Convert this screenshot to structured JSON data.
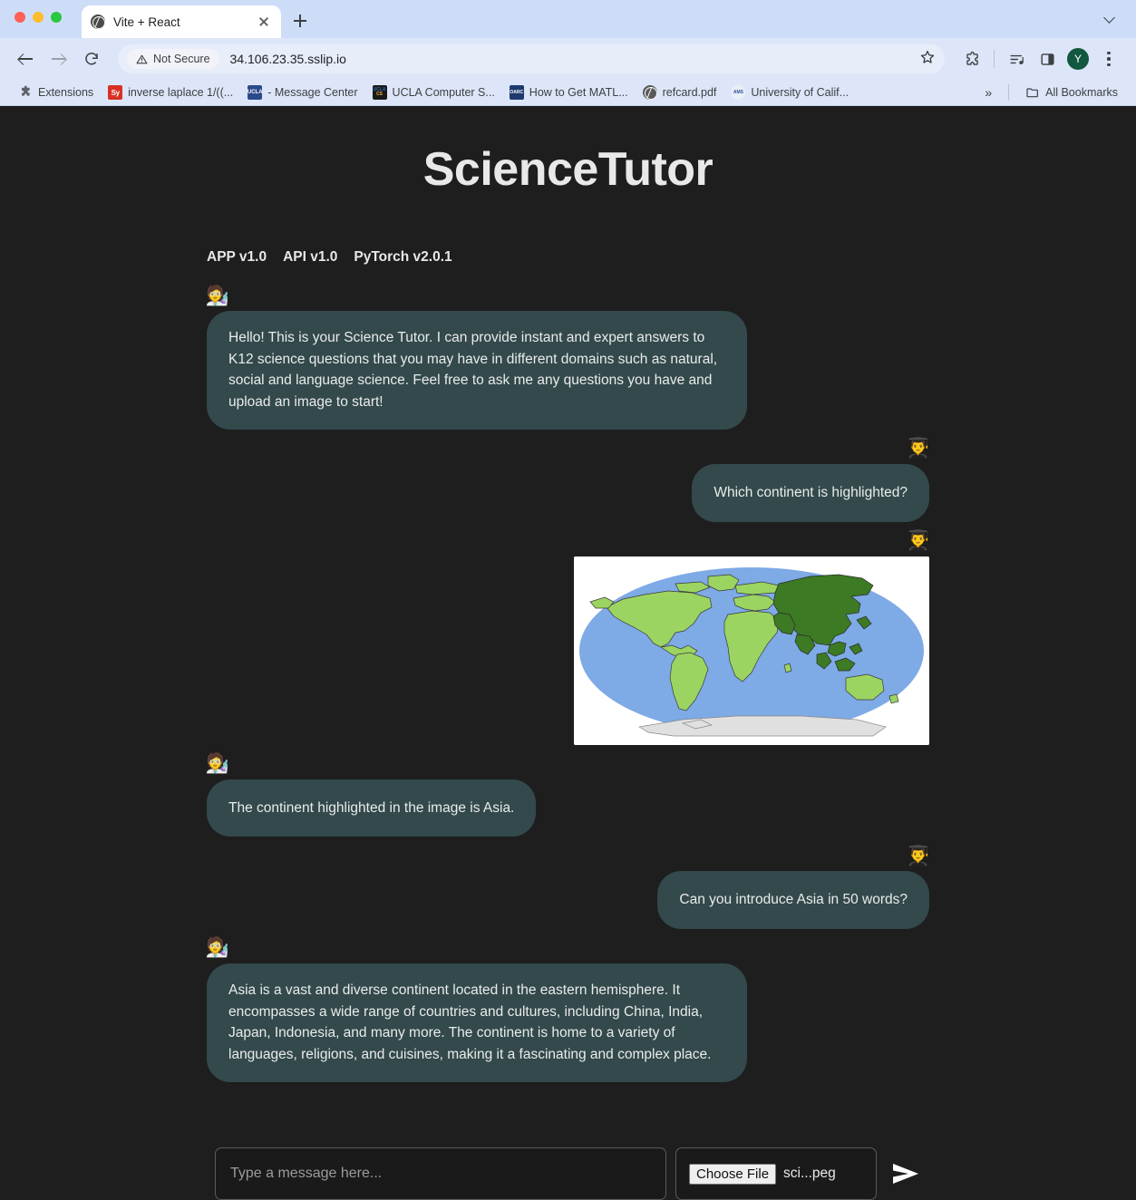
{
  "browser": {
    "tab": {
      "title": "Vite + React",
      "favicon": "globe-icon"
    },
    "new_tab_label": "+",
    "nav": {
      "back": "back-arrow-icon",
      "forward": "forward-arrow-icon",
      "reload": "reload-icon"
    },
    "omnibox": {
      "security_label": "Not Secure",
      "url": "34.106.23.35.sslip.io",
      "bookmark_star": "star-icon"
    },
    "toolbar_icons": [
      "extensions-puzzle-icon",
      "media-control-icon",
      "side-panel-icon",
      "profile-avatar",
      "browser-menu-icon"
    ],
    "profile_initial": "Y",
    "bookmarks": [
      {
        "label": "Extensions",
        "icon": "puzzle-icon"
      },
      {
        "label": "inverse laplace 1/((...",
        "icon": "symbolab-icon"
      },
      {
        "label": "- Message Center",
        "icon": "ucla-icon"
      },
      {
        "label": "UCLA Computer S...",
        "icon": "ucla-cs-icon"
      },
      {
        "label": "How to Get MATL...",
        "icon": "oarc-icon"
      },
      {
        "label": "refcard.pdf",
        "icon": "globe-icon"
      },
      {
        "label": "University of Calif...",
        "icon": "ams-icon"
      }
    ],
    "bookmarks_overflow": "»",
    "all_bookmarks_label": "All Bookmarks"
  },
  "app": {
    "title": "ScienceTutor",
    "versions": [
      "APP v1.0",
      "API v1.0",
      "PyTorch v2.0.1"
    ],
    "avatars": {
      "assistant": "🧑‍🔬",
      "user": "👨‍🎓"
    },
    "messages": [
      {
        "role": "assistant",
        "type": "text",
        "text": "Hello! This is your Science Tutor. I can provide instant and expert answers to K12 science questions that you may have in different domains such as natural, social and language science. Feel free to ask me any questions you have and upload an image to start!"
      },
      {
        "role": "user",
        "type": "text",
        "text": "Which continent is highlighted?"
      },
      {
        "role": "user",
        "type": "image",
        "alt": "World map in Robinson projection with Asia highlighted in dark green"
      },
      {
        "role": "assistant",
        "type": "text",
        "text": "The continent highlighted in the image is Asia."
      },
      {
        "role": "user",
        "type": "text",
        "text": "Can you introduce Asia in 50 words?"
      },
      {
        "role": "assistant",
        "type": "text",
        "text": "Asia is a vast and diverse continent located in the eastern hemisphere. It encompasses a wide range of countries and cultures, including China, India, Japan, Indonesia, and many more. The continent is home to a variety of languages, religions, and cuisines, making it a fascinating and complex place."
      }
    ],
    "composer": {
      "input_placeholder": "Type a message here...",
      "input_value": "",
      "choose_file_label": "Choose File",
      "file_name": "sci...peg",
      "send_icon": "send-arrow-icon"
    },
    "colors": {
      "page_background": "#1e1e1e",
      "bubble": "#33494b",
      "text": "#e9eceb",
      "map_ocean": "#7eaae6",
      "map_land": "#9cd461",
      "map_highlight": "#3c7a24",
      "map_antarctica": "#e0e0e0"
    }
  }
}
